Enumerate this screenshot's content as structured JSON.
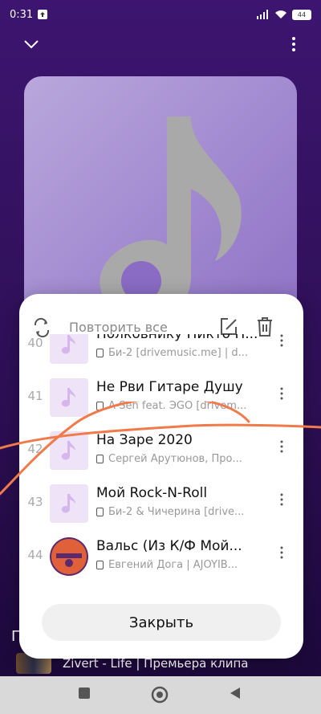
{
  "status": {
    "time": "0:31",
    "battery": "44"
  },
  "sheet": {
    "repeat_label": "Повторить все",
    "close_label": "Закрыть",
    "tracks": [
      {
        "num": "40",
        "title": "Полковнику Никто Н...",
        "sub": "Би-2 [drivemusic.me] | d..."
      },
      {
        "num": "41",
        "title": "Не Рви Гитаре Душу",
        "sub": "A-Sen feat. ЭGO [drivem..."
      },
      {
        "num": "42",
        "title": "На Заре 2020",
        "sub": "Сергей Арутюнов, Про..."
      },
      {
        "num": "43",
        "title": "Мой Rock-N-Roll",
        "sub": "Би-2 & Чичерина [drive..."
      },
      {
        "num": "44",
        "title": "Вальс (Из К/Ф Мой...",
        "sub": "Евгений Дога | AJOYIB..."
      }
    ]
  },
  "peek": {
    "letter": "П",
    "text": "Zivert - Life | Премьера клипа"
  },
  "colors": {
    "accent": "#f07a4a",
    "background": "#3a1465"
  }
}
